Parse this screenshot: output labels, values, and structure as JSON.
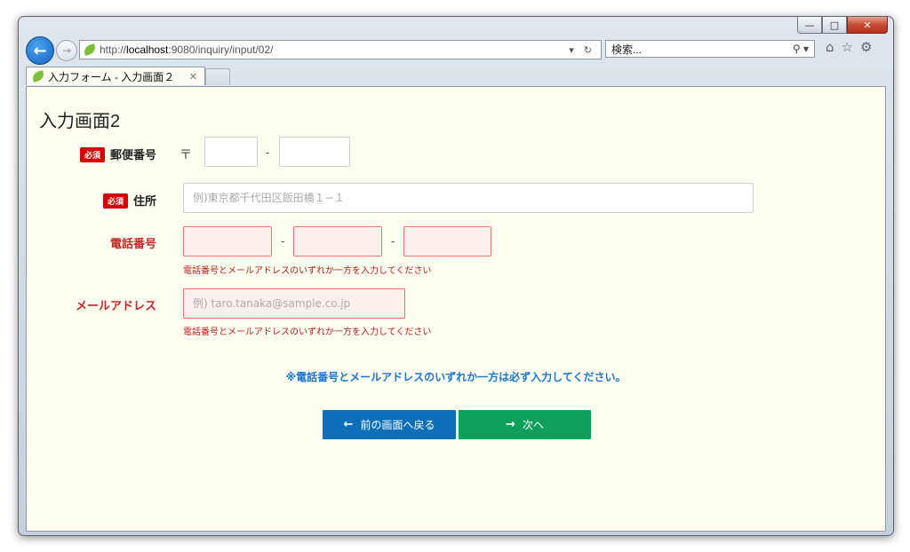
{
  "browser": {
    "url_prefix": "http://",
    "url_host": "localhost",
    "url_rest": ":9080/inquiry/input/02/",
    "search_placeholder": "検索...",
    "tab_title": "入力フォーム - 入力画面２",
    "back_icon": "back-arrow-icon",
    "forward_icon": "forward-arrow-icon"
  },
  "page": {
    "title": "入力画面2",
    "required_badge": "必須",
    "postal": {
      "label": "郵便番号",
      "mark": "〒",
      "separator": "-"
    },
    "address": {
      "label": "住所",
      "placeholder": "例)東京都千代田区飯田橋１−１"
    },
    "phone": {
      "label": "電話番号",
      "separator": "-",
      "hint": "電話番号とメールアドレスのいずれか一方を入力してください"
    },
    "email": {
      "label": "メールアドレス",
      "placeholder": "例) taro.tanaka@sample.co.jp",
      "hint": "電話番号とメールアドレスのいずれか一方を入力してください"
    },
    "notice": "※電話番号とメールアドレスのいずれか一方は必ず入力してください。",
    "back_button": "前の画面へ戻る",
    "next_button": "次へ"
  },
  "colors": {
    "page_bg": "#fefef1",
    "error": "#c62828",
    "notice": "#1976d2",
    "back_button": "#0d6fb8",
    "next_button": "#0ea05a"
  }
}
